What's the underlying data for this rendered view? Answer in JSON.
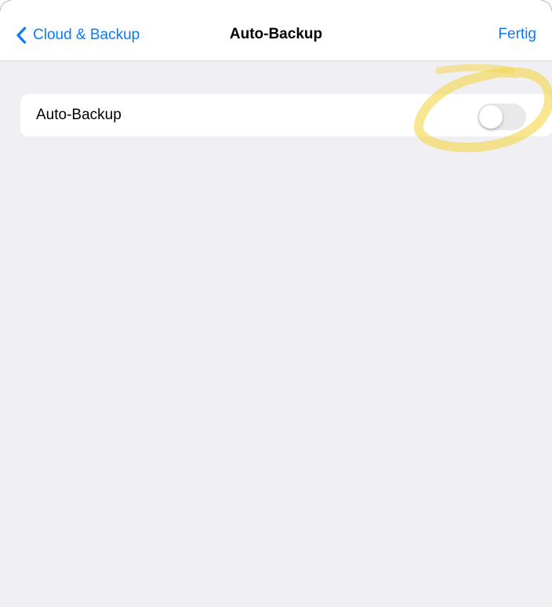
{
  "navbar": {
    "back_label": "Cloud & Backup",
    "title": "Auto-Backup",
    "done_label": "Fertig"
  },
  "settings": {
    "rows": [
      {
        "label": "Auto-Backup",
        "toggle_on": false
      }
    ]
  },
  "icons": {
    "back": "chevron-left-icon"
  },
  "colors": {
    "accent": "#0a7aff",
    "background": "#efeff4",
    "toggle_off": "#e9e9eb",
    "highlight": "#f5d547"
  }
}
